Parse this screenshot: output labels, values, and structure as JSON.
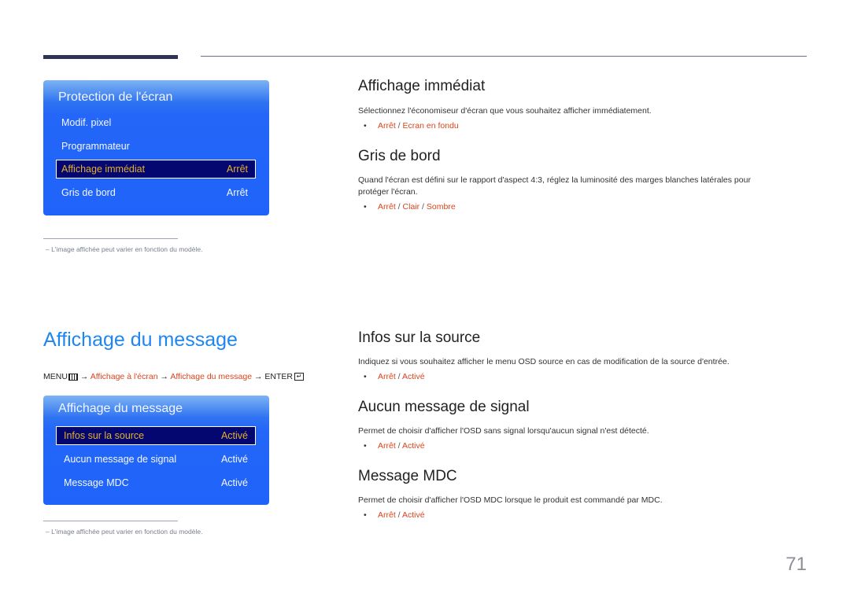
{
  "page_number": "71",
  "screen_protection": {
    "osd": {
      "title": "Protection de l'écran",
      "items": [
        {
          "label": "Modif. pixel",
          "value": ""
        },
        {
          "label": "Programmateur",
          "value": ""
        },
        {
          "label": "Affichage immédiat",
          "value": "Arrêt",
          "selected": true
        },
        {
          "label": "Gris de bord",
          "value": "Arrêt"
        }
      ]
    },
    "footnote": "–  L'image affichée peut varier en fonction du modèle.",
    "sections": [
      {
        "heading": "Affichage immédiat",
        "description": "Sélectionnez l'économiseur d'écran que vous souhaitez afficher immédiatement.",
        "options": [
          "Arrêt",
          "Ecran en fondu"
        ]
      },
      {
        "heading": "Gris de bord",
        "description": "Quand l'écran est défini sur le rapport d'aspect 4:3, réglez la luminosité des marges blanches latérales pour protéger l'écran.",
        "options": [
          "Arrêt",
          "Clair",
          "Sombre"
        ]
      }
    ]
  },
  "message_display": {
    "title": "Affichage du message",
    "menu_path": {
      "menu": "MENU",
      "step1": "Affichage à l'écran",
      "step2": "Affichage du message",
      "enter": "ENTER",
      "arrow": "→"
    },
    "osd": {
      "title": "Affichage du message",
      "items": [
        {
          "label": "Infos sur la source",
          "value": "Activé",
          "selected": true
        },
        {
          "label": "Aucun message de signal",
          "value": "Activé"
        },
        {
          "label": "Message MDC",
          "value": "Activé"
        }
      ]
    },
    "footnote": "–  L'image affichée peut varier en fonction du modèle.",
    "sections": [
      {
        "heading": "Infos sur la source",
        "description": "Indiquez si vous souhaitez afficher le menu OSD source en cas de modification de la source d'entrée.",
        "options": [
          "Arrêt",
          "Activé"
        ]
      },
      {
        "heading": "Aucun message de signal",
        "description": "Permet de choisir d'afficher l'OSD sans signal lorsqu'aucun signal n'est détecté.",
        "options": [
          "Arrêt",
          "Activé"
        ]
      },
      {
        "heading": "Message MDC",
        "description": "Permet de choisir d'afficher l'OSD MDC lorsque le produit est commandé par MDC.",
        "options": [
          "Arrêt",
          "Activé"
        ]
      }
    ]
  },
  "colors": {
    "accent_title": "#1f86ef",
    "option_red": "#d9451e",
    "osd_blue": "#1f63fa",
    "osd_selected_bg": "#050770",
    "osd_selected_text": "#e3b02c"
  }
}
